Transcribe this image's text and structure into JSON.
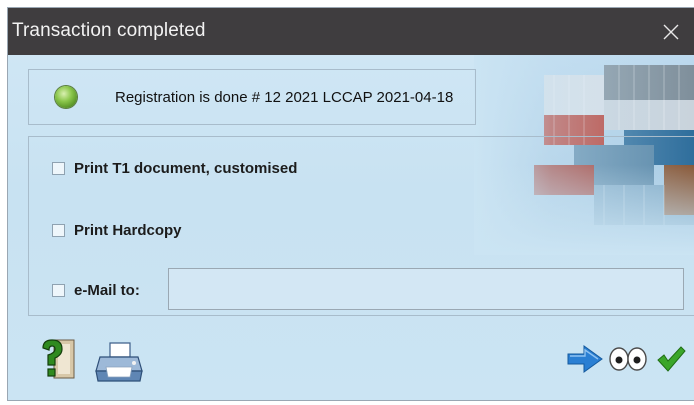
{
  "window": {
    "title": "Transaction completed",
    "close_glyph": "✕"
  },
  "status": {
    "indicator_color": "#7cc242",
    "message": "Registration is done # 12 2021 LCCAP 2021-04-18"
  },
  "options": [
    {
      "label": "Print T1 document, customised",
      "checked": false
    },
    {
      "label": "Print Hardcopy",
      "checked": false
    },
    {
      "label": "e-Mail to:",
      "checked": false
    }
  ],
  "email": {
    "value": "",
    "placeholder": ""
  },
  "toolbar": {
    "left": [
      {
        "icon": "help-icon"
      },
      {
        "icon": "printer-icon"
      }
    ],
    "right": [
      {
        "icon": "arrow-right-icon"
      },
      {
        "icon": "eyes-icon"
      },
      {
        "icon": "check-icon"
      }
    ]
  },
  "colors": {
    "titlebar": "#3f3d3f",
    "client_bg": "#cfe6f4",
    "arrow": "#2a7fd3",
    "check": "#3ba62a"
  }
}
